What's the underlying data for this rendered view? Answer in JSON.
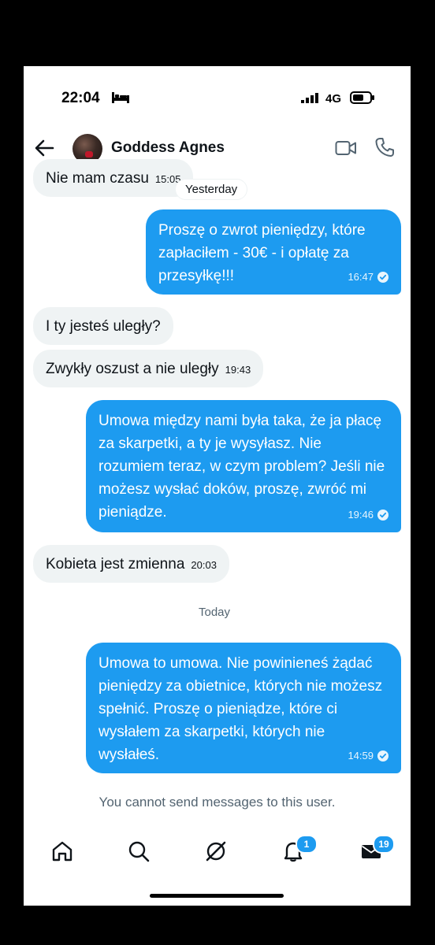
{
  "status_bar": {
    "time": "22:04",
    "network": "4G"
  },
  "header": {
    "contact_name": "Goddess Agnes"
  },
  "messages": {
    "m0": {
      "text": "Nie mam czasu",
      "time": "15:05"
    },
    "day1": "Yesterday",
    "m1": {
      "text": "Proszę o zwrot pieniędzy, które zapłaciłem - 30€ - i opłatę za przesyłkę!!!",
      "time": "16:47"
    },
    "m2": {
      "text": "I ty jesteś uległy?"
    },
    "m3": {
      "text": "Zwykły oszust a nie uległy",
      "time": "19:43"
    },
    "m4": {
      "text": "Umowa między nami była taka, że ja płacę za skarpetki, a ty je wysyłasz. Nie rozumiem teraz, w czym problem? Jeśli nie możesz wysłać doków, proszę, zwróć mi pieniądze.",
      "time": "19:46"
    },
    "m5": {
      "text": "Kobieta jest zmienna",
      "time": "20:03"
    },
    "day2": "Today",
    "m6": {
      "text": "Umowa to umowa. Nie powinieneś żądać pieniędzy za obietnice, których nie możesz spełnić. Proszę o pieniądze, które ci wysłałem za skarpetki, których nie wysłałeś.",
      "time": "14:59"
    }
  },
  "notice": "You cannot send messages to this user.",
  "nav": {
    "notifications_badge": "1",
    "messages_badge": "19",
    "icons": [
      "home-icon",
      "search-icon",
      "grok-icon",
      "bell-icon",
      "mail-icon"
    ]
  },
  "colors": {
    "accent": "#1d9bf0",
    "incoming_bubble": "#eff3f4",
    "muted_text": "#536471"
  }
}
